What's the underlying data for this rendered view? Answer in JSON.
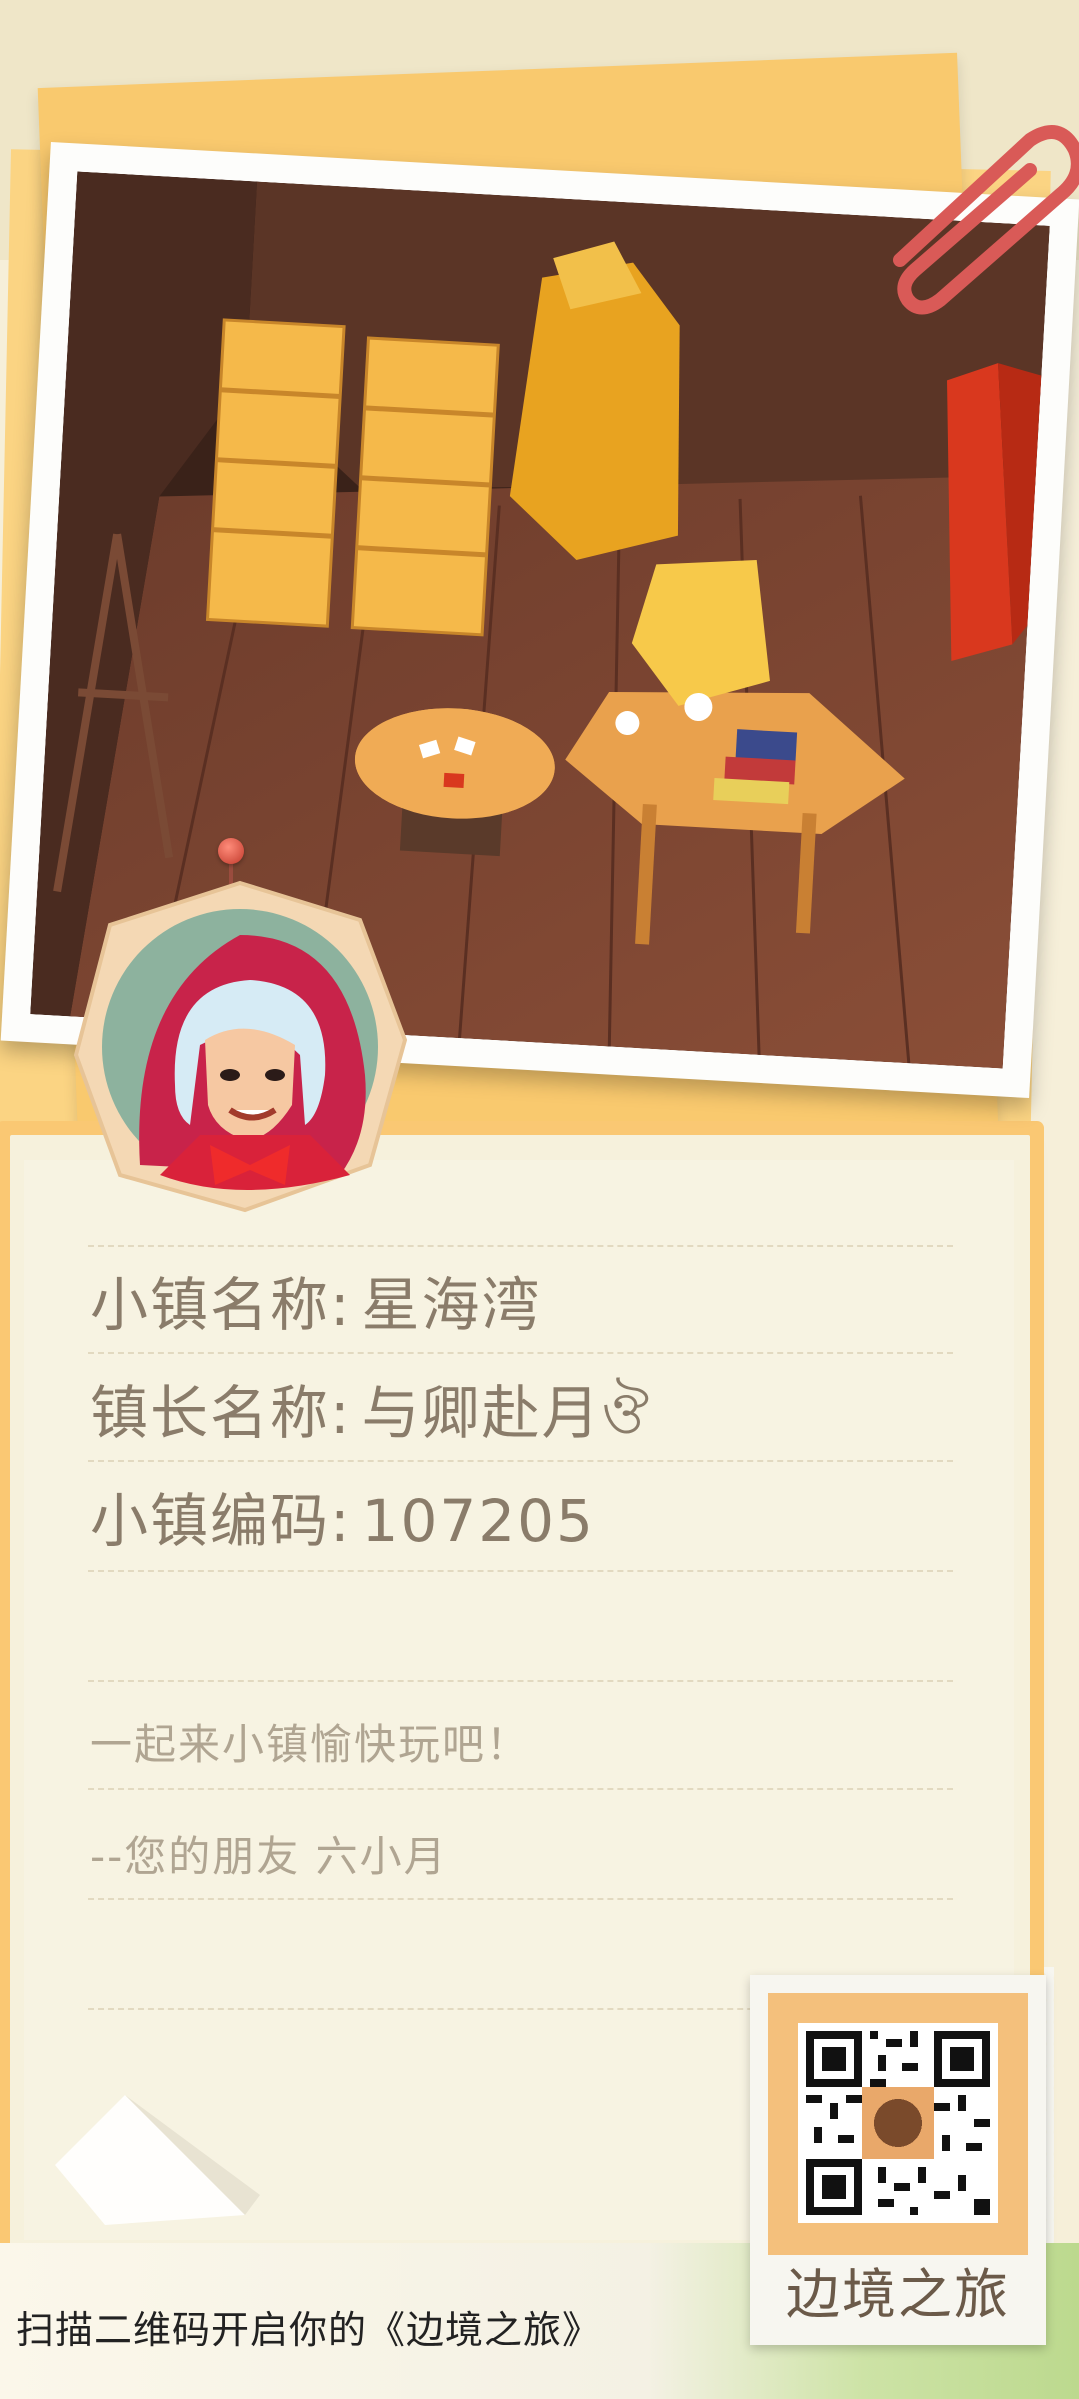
{
  "town": {
    "name_label": "小镇名称:",
    "name_value": "星海湾",
    "mayor_label": "镇长名称:",
    "mayor_value": "与卿赴月ঔ",
    "code_label": "小镇编码:",
    "code_value": "107205"
  },
  "note": {
    "line1": "一起来小镇愉快玩吧！",
    "line2": "--您的朋友 六小月"
  },
  "stamp": {
    "title": "边境之旅"
  },
  "footer": {
    "cta": "扫描二维码开启你的《边境之旅》"
  },
  "colors": {
    "card_border": "#fac873",
    "paper": "#f6f1dc",
    "text_primary": "#8a7c6a",
    "text_secondary": "#b0a592",
    "clip": "#d95a57"
  },
  "icons": [
    "paper-clip-icon",
    "avatar-portrait",
    "qr-code",
    "pushpin-icon"
  ]
}
